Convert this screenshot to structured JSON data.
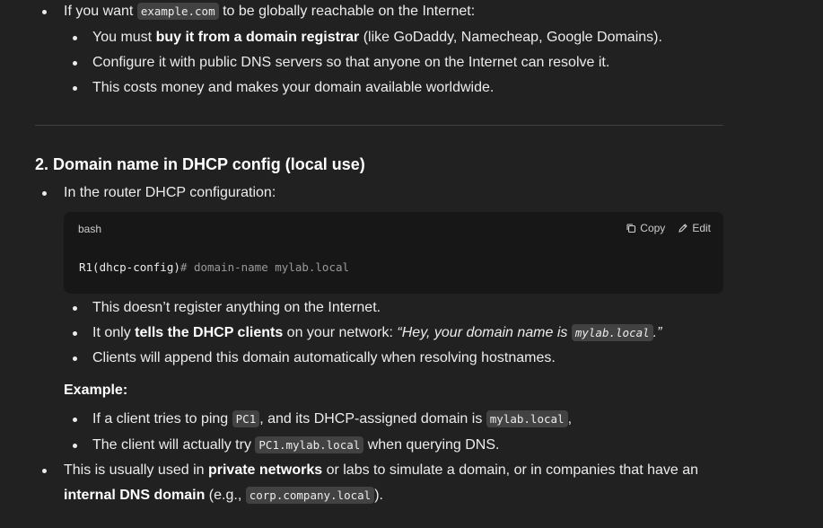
{
  "top_list": {
    "item1": {
      "pre": "If you want ",
      "code": "example.com",
      "post": " to be globally reachable on the Internet:"
    },
    "sub1": {
      "pre": "You must ",
      "bold": "buy it from a domain registrar",
      "post": " (like GoDaddy, Namecheap, Google Domains)."
    },
    "sub2": "Configure it with public DNS servers so that anyone on the Internet can resolve it.",
    "sub3": "This costs money and makes your domain available worldwide."
  },
  "section2": {
    "heading": "2. Domain name in DHCP config (local use)",
    "intro": "In the router DHCP configuration:",
    "codeblock": {
      "language": "bash",
      "copy_label": "Copy",
      "edit_label": "Edit",
      "prompt": "R1(dhcp-config)",
      "rest": "# domain-name mylab.local"
    },
    "points": {
      "p1": "This doesn’t register anything on the Internet.",
      "p2_pre": "It only ",
      "p2_bold": "tells the DHCP clients",
      "p2_mid": " on your network: ",
      "p2_italic": "“Hey, your domain name is ",
      "p2_code": "mylab.local",
      "p2_end": ".”",
      "p3": "Clients will append this domain automatically when resolving hostnames."
    },
    "example_label": "Example:",
    "example": {
      "e1_pre": "If a client tries to ping ",
      "e1_code1": "PC1",
      "e1_mid": ", and its DHCP-assigned domain is ",
      "e1_code2": "mylab.local",
      "e1_end": ",",
      "e2_pre": "The client will actually try ",
      "e2_code": "PC1.mylab.local",
      "e2_post": " when querying DNS."
    },
    "usage": {
      "pre": "This is usually used in ",
      "bold1": "private networks",
      "post1": " or labs to simulate a domain, or in companies that have an",
      "bold2": "internal DNS domain",
      "mid": " (e.g., ",
      "code": "corp.company.local",
      "end": ")."
    }
  }
}
